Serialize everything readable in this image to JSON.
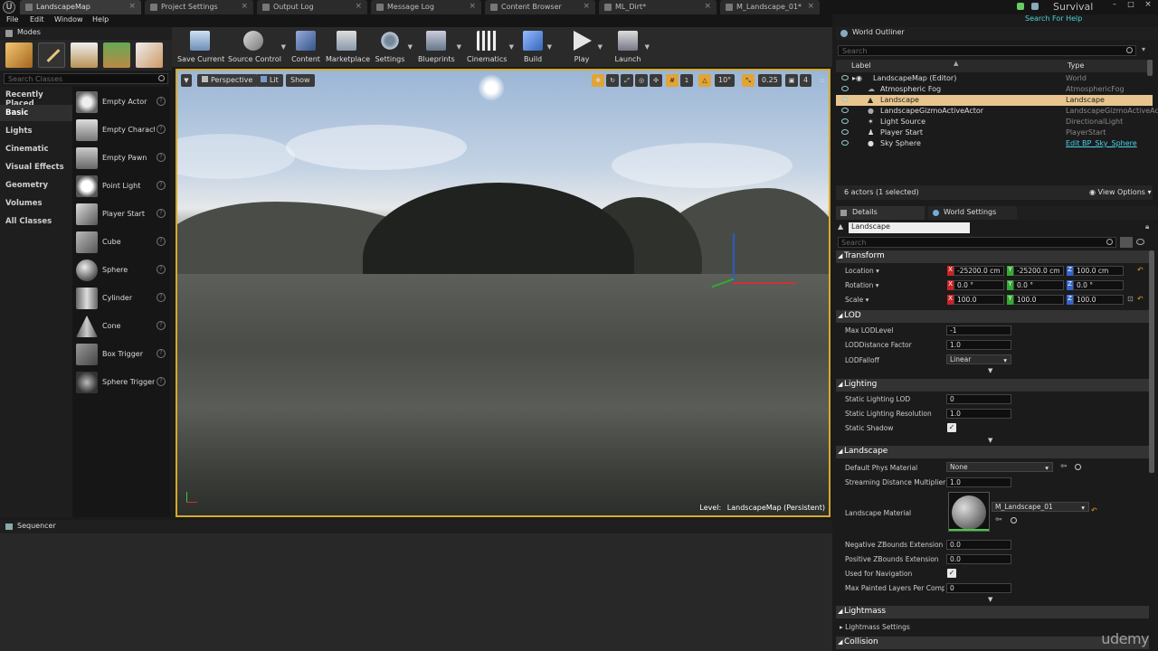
{
  "window": {
    "tabs": [
      "LandscapeMap",
      "Project Settings",
      "Output Log",
      "Message Log",
      "Content Browser",
      "ML_Dirt*",
      "M_Landscape_01*"
    ],
    "project": "Survival",
    "search_help_placeholder": "Search For Help"
  },
  "menu": [
    "File",
    "Edit",
    "Window",
    "Help"
  ],
  "modes": {
    "tab_label": "Modes",
    "search_placeholder": "Search Classes",
    "categories": [
      "Recently Placed",
      "Basic",
      "Lights",
      "Cinematic",
      "Visual Effects",
      "Geometry",
      "Volumes",
      "All Classes"
    ],
    "items": [
      "Empty Actor",
      "Empty Charact",
      "Empty Pawn",
      "Point Light",
      "Player Start",
      "Cube",
      "Sphere",
      "Cylinder",
      "Cone",
      "Box Trigger",
      "Sphere Trigger"
    ]
  },
  "toolbar": [
    "Save Current",
    "Source Control",
    "Content",
    "Marketplace",
    "Settings",
    "Blueprints",
    "Cinematics",
    "Build",
    "Play",
    "Launch"
  ],
  "viewport": {
    "perspective": "Perspective",
    "lit": "Lit",
    "show": "Show",
    "angle_snap": "10°",
    "scale_snap": "0.25",
    "camera_speed": "4",
    "level_label": "Level:",
    "level_name": "LandscapeMap (Persistent)"
  },
  "sequencer": {
    "tab_label": "Sequencer"
  },
  "outliner": {
    "tab_label": "World Outliner",
    "search_placeholder": "Search",
    "col_label": "Label",
    "col_type": "Type",
    "rows": [
      {
        "name": "LandscapeMap (Editor)",
        "type": "World"
      },
      {
        "name": "Atmospheric Fog",
        "type": "AtmosphericFog"
      },
      {
        "name": "Landscape",
        "type": "Landscape"
      },
      {
        "name": "LandscapeGizmoActiveActor",
        "type": "LandscapeGizmoActiveActor"
      },
      {
        "name": "Light Source",
        "type": "DirectionalLight"
      },
      {
        "name": "Player Start",
        "type": "PlayerStart"
      },
      {
        "name": "Sky Sphere",
        "type": "Edit BP_Sky_Sphere"
      }
    ],
    "summary": "6 actors (1 selected)",
    "view_options": "View Options"
  },
  "details": {
    "tab_label": "Details",
    "world_settings_tab": "World Settings",
    "actor_name": "Landscape",
    "search_placeholder": "Search",
    "transform": {
      "title": "Transform",
      "location_label": "Location",
      "location": [
        "-25200.0 cm",
        "-25200.0 cm",
        "100.0 cm"
      ],
      "rotation_label": "Rotation",
      "rotation": [
        "0.0 °",
        "0.0 °",
        "0.0 °"
      ],
      "scale_label": "Scale",
      "scale": [
        "100.0",
        "100.0",
        "100.0"
      ]
    },
    "lod": {
      "title": "LOD",
      "max_lod_label": "Max LODLevel",
      "max_lod": "-1",
      "distance_factor_label": "LODDistance Factor",
      "distance_factor": "1.0",
      "falloff_label": "LODFalloff",
      "falloff": "Linear"
    },
    "lighting": {
      "title": "Lighting",
      "static_lod_label": "Static Lighting LOD",
      "static_lod": "0",
      "resolution_label": "Static Lighting Resolution",
      "resolution": "1.0",
      "shadow_label": "Static Shadow"
    },
    "landscape": {
      "title": "Landscape",
      "phys_label": "Default Phys Material",
      "phys": "None",
      "stream_label": "Streaming Distance Multiplier",
      "stream": "1.0",
      "material_label": "Landscape Material",
      "material": "M_Landscape_01",
      "negz_label": "Negative ZBounds Extension",
      "negz": "0.0",
      "posz_label": "Positive ZBounds Extension",
      "posz": "0.0",
      "nav_label": "Used for Navigation",
      "painted_label": "Max Painted Layers Per Compor",
      "painted": "0"
    },
    "lightmass": {
      "title": "Lightmass",
      "settings": "Lightmass Settings"
    },
    "collision": {
      "title": "Collision"
    }
  },
  "watermark": "udemy",
  "colors": {
    "accent": "#d7a92a",
    "selection": "#e8c58e"
  }
}
